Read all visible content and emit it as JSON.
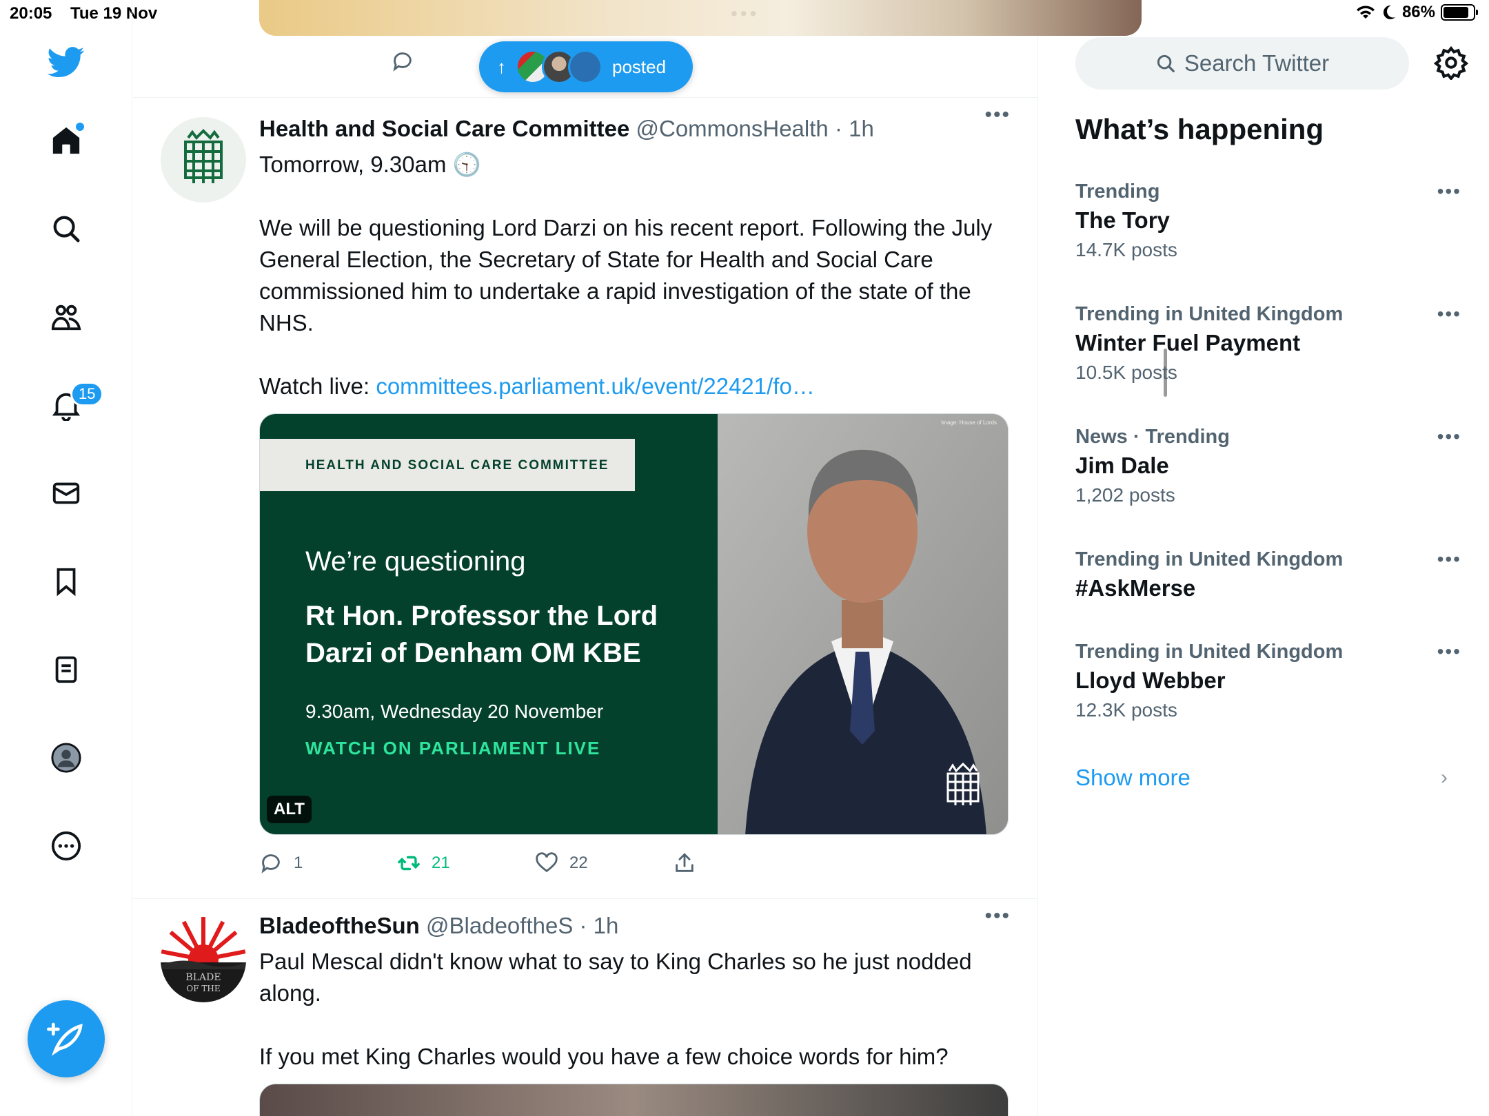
{
  "status_bar": {
    "time": "20:05",
    "date": "Tue 19 Nov",
    "battery": "86%",
    "battery_level": 0.86
  },
  "nav": {
    "notifications_badge": "15",
    "compose_label": "Post"
  },
  "posted_pill": {
    "label": "posted",
    "arrow": "↑"
  },
  "tweets": [
    {
      "name": "Health and Social Care Committee",
      "handle": "@CommonsHealth",
      "time": "· 1h",
      "line1": "Tomorrow, 9.30am",
      "clock_emoji": "🕤",
      "para": "We will be questioning Lord Darzi on his recent report. Following the July General Election, the Secretary of State for Health and Social Care commissioned him to undertake a rapid investigation of the state of the NHS.",
      "watch_label": "Watch live: ",
      "link": "committees.parliament.uk/event/22421/fo…",
      "media": {
        "banner": "HEALTH AND SOCIAL CARE COMMITTEE",
        "q1": "We’re questioning",
        "q2": "Rt Hon. Professor the Lord Darzi of Denham OM KBE",
        "q3": "9.30am, Wednesday 20 November",
        "q4": "WATCH ON PARLIAMENT LIVE",
        "alt": "ALT",
        "credit": "Image: House of Lords"
      },
      "replies": "1",
      "retweets": "21",
      "likes": "22"
    },
    {
      "name": "BladeoftheSun",
      "handle": "@BladeoftheS",
      "time": "· 1h",
      "para1": "Paul Mescal didn't know what to say to King Charles so he just nodded along.",
      "para2": "If you met King Charles would you have a few choice words for him?"
    }
  ],
  "sidebar": {
    "search_placeholder": "Search Twitter",
    "title": "What’s happening",
    "trends": [
      {
        "context": "Trending",
        "topic": "The Tory",
        "count": "14.7K posts"
      },
      {
        "context": "Trending in United Kingdom",
        "topic": "Winter Fuel Payment",
        "count": "10.5K posts"
      },
      {
        "context": "News · Trending",
        "topic": "Jim Dale",
        "count": "1,202 posts"
      },
      {
        "context": "Trending in United Kingdom",
        "topic": "#AskMerse",
        "count": ""
      },
      {
        "context": "Trending in United Kingdom",
        "topic": "Lloyd Webber",
        "count": "12.3K posts"
      }
    ],
    "show_more": "Show more"
  },
  "colors": {
    "accent": "#1d9bf0",
    "retweet_green": "#00ba7c",
    "committee_green": "#04412c"
  },
  "icons": [
    "twitter-logo-icon",
    "home-icon",
    "search-icon",
    "communities-icon",
    "bell-icon",
    "mail-icon",
    "bookmark-icon",
    "lists-icon",
    "profile-icon",
    "more-circle-icon",
    "compose-icon",
    "reply-icon",
    "retweet-icon",
    "like-icon",
    "share-icon",
    "gear-icon",
    "wifi-icon",
    "moon-icon",
    "battery-icon"
  ]
}
